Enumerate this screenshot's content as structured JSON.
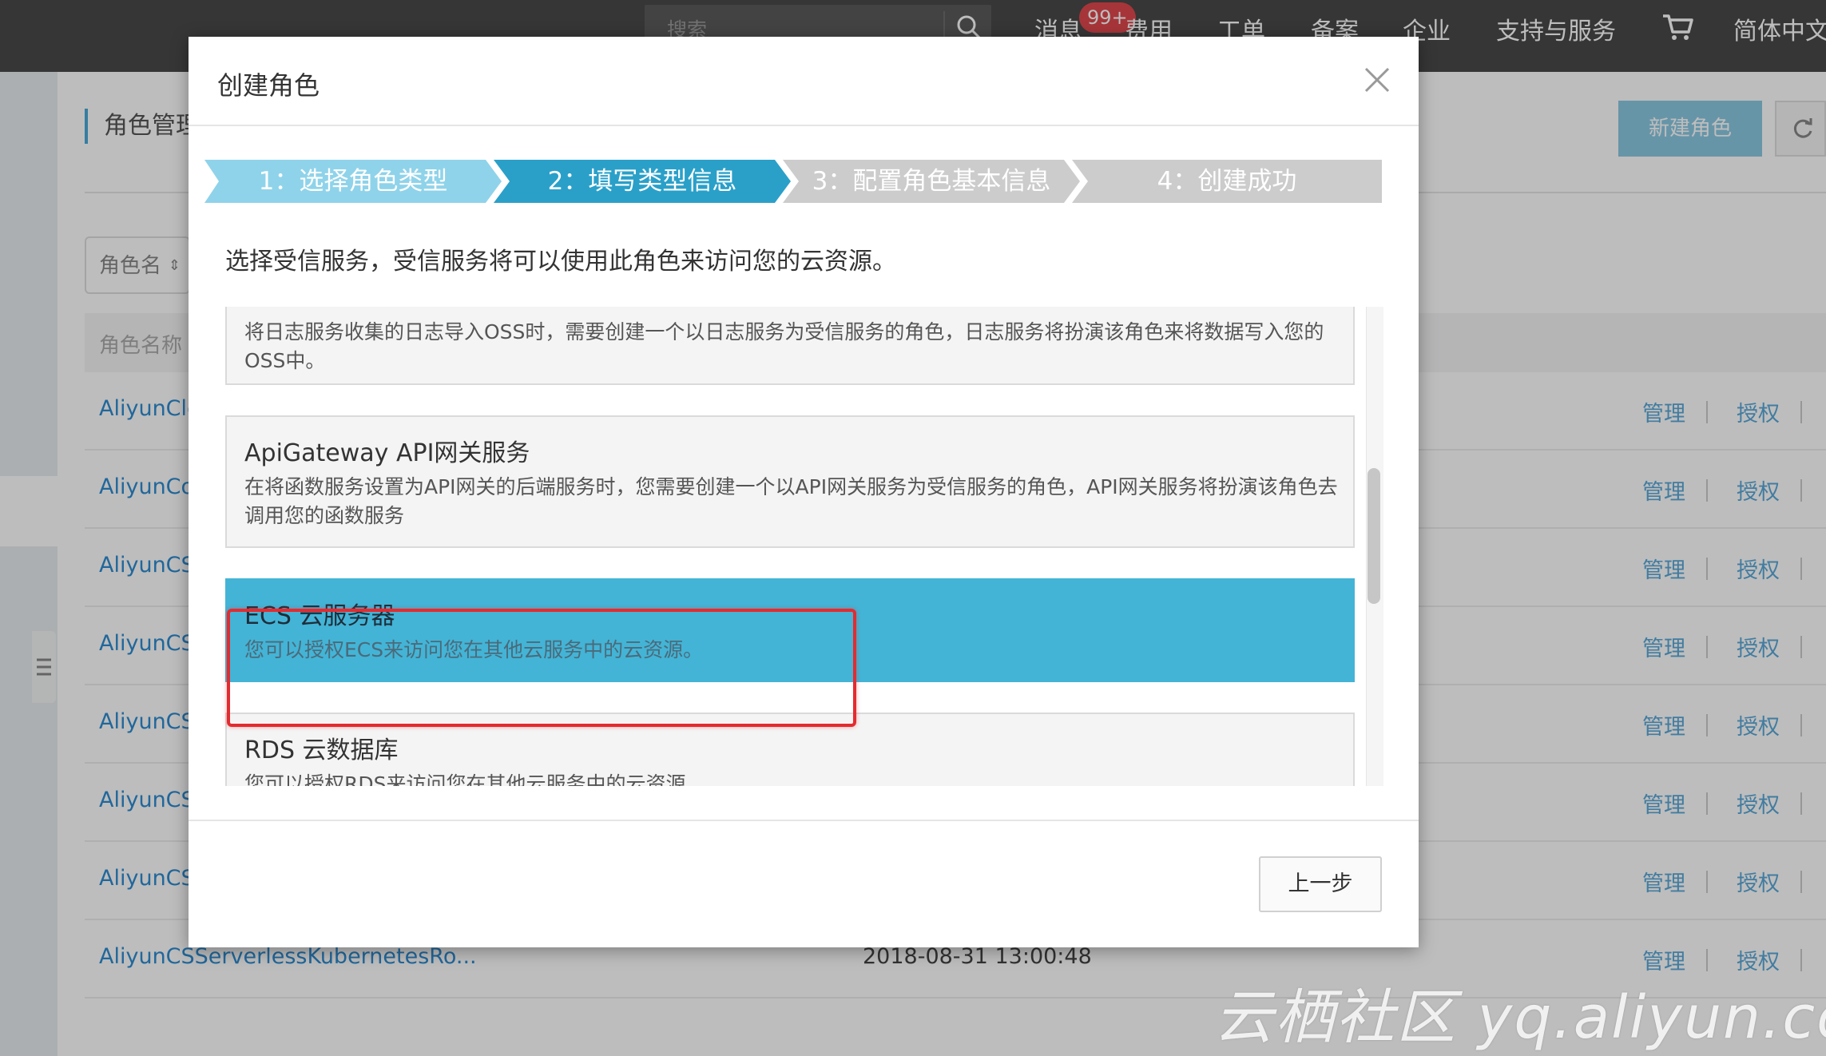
{
  "topbar": {
    "search_placeholder": "搜索",
    "nav": {
      "messages": "消息",
      "messages_badge": "99+",
      "billing": "费用",
      "tickets": "工单",
      "icp": "备案",
      "enterprise": "企业",
      "support": "支持与服务",
      "language": "简体中文"
    }
  },
  "page": {
    "title": "角色管理",
    "new_role_button": "新建角色",
    "filter_select": "角色名",
    "table_header_name": "角色名称",
    "rows": [
      {
        "name": "AliyunClo",
        "date": "",
        "manage": "管理",
        "grant": "授权"
      },
      {
        "name": "AliyunCod",
        "date": "",
        "manage": "管理",
        "grant": "授权"
      },
      {
        "name": "AliyunCSD",
        "date": "",
        "manage": "管理",
        "grant": "授权"
      },
      {
        "name": "AliyunCSD",
        "date": "",
        "manage": "管理",
        "grant": "授权"
      },
      {
        "name": "AliyunCSM",
        "date": "",
        "manage": "管理",
        "grant": "授权"
      },
      {
        "name": "AliyunCSM",
        "date": "",
        "manage": "管理",
        "grant": "授权"
      },
      {
        "name": "AliyunCSM",
        "date": "",
        "manage": "管理",
        "grant": "授权"
      },
      {
        "name": "AliyunCSServerlessKubernetesRo...",
        "date": "2018-08-31 13:00:48",
        "manage": "管理",
        "grant": "授权"
      }
    ],
    "watermark": "云栖社区 yq.aliyun.com"
  },
  "modal": {
    "title": "创建角色",
    "steps": [
      {
        "label": "1：选择角色类型"
      },
      {
        "label": "2：填写类型信息"
      },
      {
        "label": "3：配置角色基本信息"
      },
      {
        "label": "4：创建成功"
      }
    ],
    "instruction": "选择受信服务，受信服务将可以使用此角色来访问您的云资源。",
    "services": [
      {
        "title": "",
        "desc": "将日志服务收集的日志导入OSS时，需要创建一个以日志服务为受信服务的角色，日志服务将扮演该角色来将数据写入您的OSS中。"
      },
      {
        "title": "ApiGateway API网关服务",
        "desc": "在将函数服务设置为API网关的后端服务时，您需要创建一个以API网关服务为受信服务的角色，API网关服务将扮演该角色去调用您的函数服务"
      },
      {
        "title": "ECS 云服务器",
        "desc": "您可以授权ECS来访问您在其他云服务中的云资源。"
      },
      {
        "title": "RDS 云数据库",
        "desc": "您可以授权RDS来访问您在其他云服务中的云资源。"
      }
    ],
    "prev_button": "上一步"
  },
  "colors": {
    "step_done": "#8fd3ea",
    "step_active": "#2aa0c9",
    "step_todo": "#cccccc",
    "selected_service": "#43b4d6",
    "highlight_border": "#e42b2f"
  }
}
